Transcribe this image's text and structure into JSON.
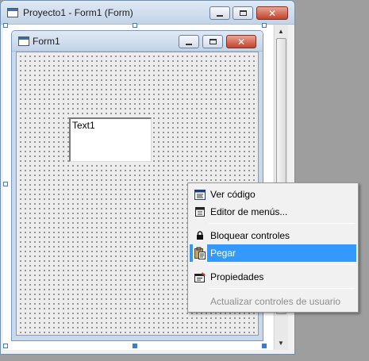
{
  "outer_window": {
    "title": "Proyecto1 - Form1 (Form)",
    "buttons": {
      "minimize": "minimize",
      "maximize": "maximize",
      "close": "close"
    }
  },
  "form": {
    "title": "Form1",
    "textbox_text": "Text1"
  },
  "context_menu": {
    "items": [
      {
        "label": "Ver código",
        "icon": "code-window-icon",
        "state": "normal"
      },
      {
        "label": "Editor de menús...",
        "icon": "menu-editor-icon",
        "state": "normal"
      },
      {
        "label": "Bloquear controles",
        "icon": "lock-icon",
        "state": "normal"
      },
      {
        "label": "Pegar",
        "icon": "paste-icon",
        "state": "selected"
      },
      {
        "label": "Propiedades",
        "icon": "properties-icon",
        "state": "normal"
      },
      {
        "label": "Actualizar controles de usuario",
        "icon": "",
        "state": "disabled"
      }
    ]
  },
  "colors": {
    "selection": "#3399ff",
    "close_button": "#c2432c",
    "handle": "#3a7bd5",
    "title_gradient_top": "#dfe9f5"
  }
}
